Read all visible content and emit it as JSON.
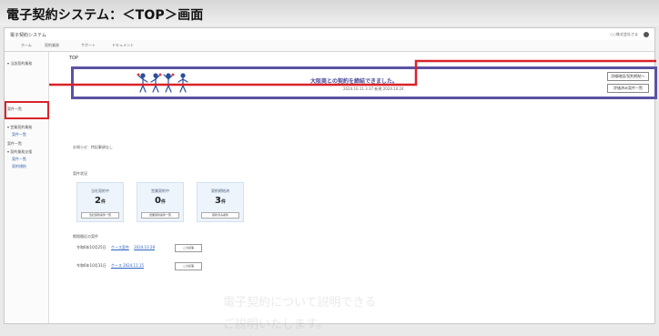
{
  "heading": {
    "title": "電子契約システム：＜TOP＞画面"
  },
  "app": {
    "title": "電子契約システム",
    "user_link": "○○株式会社さま"
  },
  "nav": {
    "tabs": [
      "ホーム",
      "契約業務",
      "サポート",
      "ドキュメント"
    ]
  },
  "sidebar": {
    "items": [
      {
        "label": "▾ 当該契約業務",
        "child": false
      },
      {
        "label": "案件一覧",
        "child": false
      },
      {
        "label": "▾ 営業契約業務",
        "child": false
      },
      {
        "label": "案件一覧",
        "child": true
      },
      {
        "label": "案件一覧",
        "child": false
      },
      {
        "label": "▾ 契約業務支援",
        "child": false
      },
      {
        "label": "案件一覧",
        "child": true
      },
      {
        "label": "契約規則",
        "child": true
      }
    ]
  },
  "main": {
    "page_title": "TOP",
    "banner": {
      "message": "大阪商との契約を締結できました。",
      "sub": "2024.10.11  3:37 新規  2024.10.24",
      "btn1": "詳細確認/契約締結へ",
      "btn2": "評価済み案件一覧"
    },
    "info": "お知らせ：特記事項なし",
    "summary_label": "案件状況",
    "cards": [
      {
        "label": "当社契約中",
        "count": "2",
        "unit": "件",
        "button": "当社契約案件一覧"
      },
      {
        "label": "営業契約中",
        "count": "0",
        "unit": "件",
        "button": "営業契約案件一覧"
      },
      {
        "label": "契約締結済",
        "count": "3",
        "unit": "件",
        "button": "契約済み案件"
      }
    ],
    "recent_label": "期限間近の案件",
    "recent": [
      {
        "date": "令和6年10月25日",
        "link1": "ケース案件",
        "link2": "2024.10.28",
        "button": "この記事"
      },
      {
        "date": "令和6年10月31日",
        "link1": "ケース 2024.11.15",
        "link2": "",
        "button": "この記事"
      }
    ],
    "ghost_text": [
      "電子契約について説明できる",
      "ご説明いたします。"
    ]
  }
}
